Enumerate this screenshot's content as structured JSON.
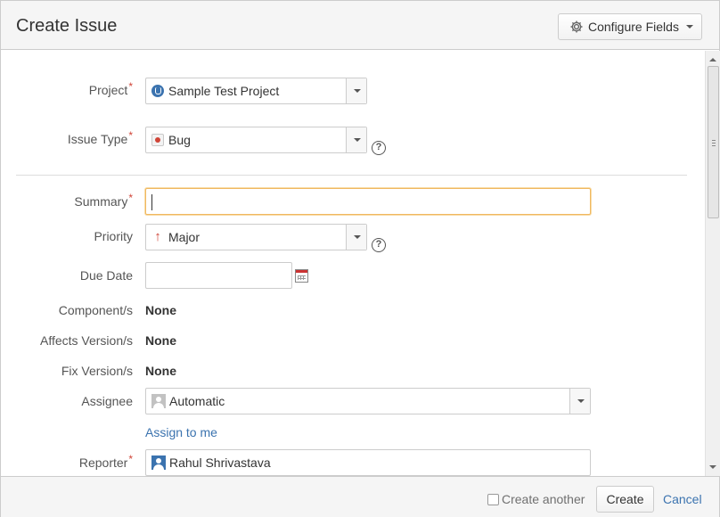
{
  "header": {
    "title": "Create Issue",
    "configure_label": "Configure Fields"
  },
  "form": {
    "project": {
      "label": "Project",
      "value": "Sample Test Project",
      "required": "*"
    },
    "issue_type": {
      "label": "Issue Type",
      "value": "Bug",
      "required": "*",
      "help": "?"
    },
    "summary": {
      "label": "Summary",
      "value": "",
      "required": "*"
    },
    "priority": {
      "label": "Priority",
      "value": "Major",
      "help": "?",
      "arrow": "↑"
    },
    "due_date": {
      "label": "Due Date",
      "value": ""
    },
    "components": {
      "label": "Component/s",
      "value": "None"
    },
    "affects_version": {
      "label": "Affects Version/s",
      "value": "None"
    },
    "fix_version": {
      "label": "Fix Version/s",
      "value": "None"
    },
    "assignee": {
      "label": "Assignee",
      "value": "Automatic",
      "assign_to_me": "Assign to me"
    },
    "reporter": {
      "label": "Reporter",
      "value": "Rahul Shrivastava",
      "required": "*"
    }
  },
  "footer": {
    "create_another_label": "Create another",
    "create_label": "Create",
    "cancel_label": "Cancel"
  },
  "colors": {
    "required": "#d04437",
    "link": "#3b73af",
    "focus": "#f0b860"
  },
  "icons": {
    "configure": "gear-icon",
    "project": "project-avatar-icon",
    "bug": "bug-icon",
    "priority": "priority-major-icon",
    "calendar": "calendar-icon",
    "assignee": "user-avatar-icon",
    "reporter": "user-avatar-icon"
  }
}
